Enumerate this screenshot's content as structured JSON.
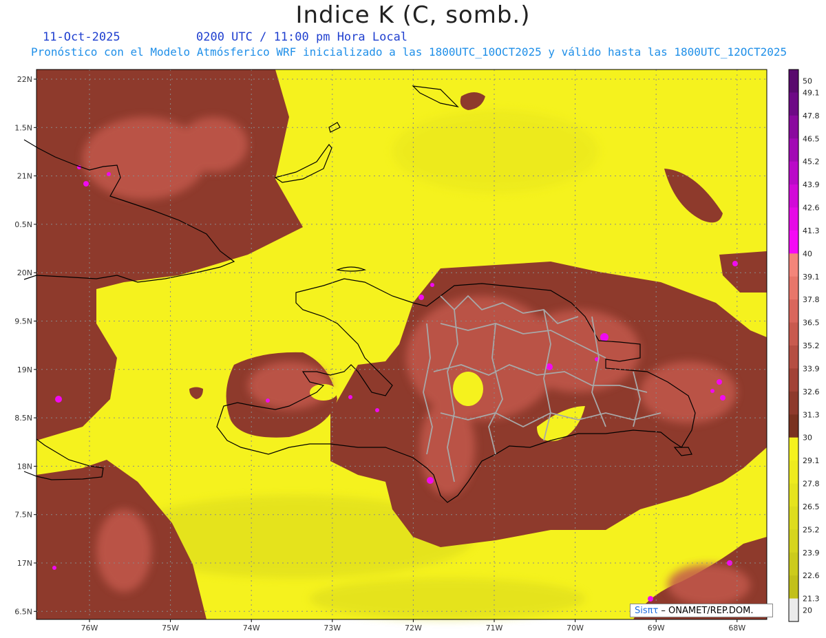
{
  "header": {
    "title": "Indice K (C, somb.)",
    "date": "11-Oct-2025",
    "time": "0200 UTC / 11:00 pm Hora Local",
    "forecast": "Pronóstico con el Modelo Atmósferico WRF inicializado a las 1800UTC_10OCT2025 y válido hasta las  1800UTC_12OCT2025"
  },
  "axes": {
    "lat_labels": [
      "22N",
      "1.5N",
      "21N",
      "0.5N",
      "20N",
      "9.5N",
      "19N",
      "8.5N",
      "18N",
      "7.5N",
      "17N",
      "6.5N"
    ],
    "lon_labels": [
      "76W",
      "75W",
      "74W",
      "73W",
      "72W",
      "71W",
      "70W",
      "69W",
      "68W"
    ]
  },
  "colorbar": {
    "labels": [
      "50",
      "49.1",
      "47.8",
      "46.5",
      "45.2",
      "43.9",
      "42.6",
      "41.3",
      "40",
      "39.1",
      "37.8",
      "36.5",
      "35.2",
      "33.9",
      "32.6",
      "31.3",
      "30",
      "29.1",
      "27.8",
      "26.5",
      "25.2",
      "23.9",
      "22.6",
      "21.3",
      "20"
    ],
    "colors": [
      "#5a0a6e",
      "#6e0a86",
      "#8a0a9e",
      "#a20ab4",
      "#ba0ac8",
      "#d20ad8",
      "#e60ae6",
      "#f50af5",
      "#f4857a",
      "#e8766a",
      "#d9665c",
      "#c85a4e",
      "#b54e42",
      "#a24236",
      "#8e3a2c",
      "#7a3220",
      "#f5f21e",
      "#eeeb1e",
      "#e6e41e",
      "#dedd1e",
      "#d6d51e",
      "#cccb1c",
      "#c2c01a",
      "#ebebeb"
    ]
  },
  "colors": {
    "yellow": "#f5f21e",
    "brown": "#8e3a2c",
    "brown_light": "#c2584c",
    "magenta": "#f00af0",
    "grid": "#9a9a9a"
  },
  "credit": {
    "brand": "Sisπτ",
    "text": " – ONAMET/REP.DOM."
  }
}
